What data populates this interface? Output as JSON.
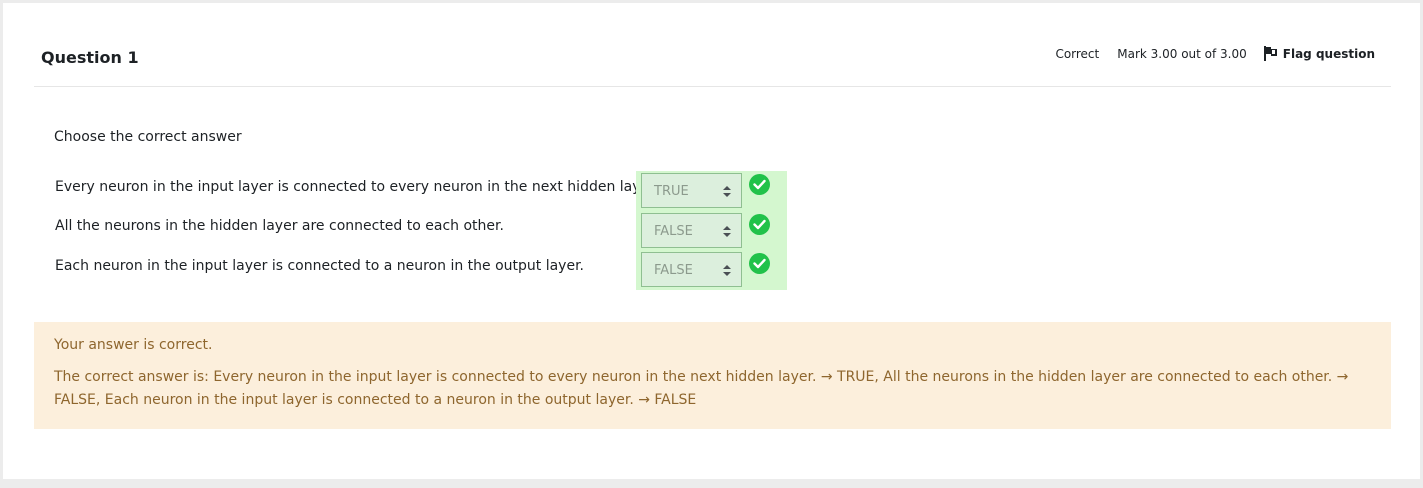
{
  "question": {
    "title": "Question 1",
    "state": "Correct",
    "grade": "Mark 3.00 out of 3.00",
    "flag_label": "Flag question",
    "prompt": "Choose the correct answer"
  },
  "rows": [
    {
      "text": "Every neuron in the input layer is connected to every neuron in the next hidden layer.",
      "selected": "TRUE"
    },
    {
      "text": "All the neurons in the hidden layer are connected to each other.",
      "selected": "FALSE"
    },
    {
      "text": "Each neuron in the input layer is connected to a neuron in the output layer.",
      "selected": "FALSE"
    }
  ],
  "feedback": {
    "specific": "Your answer is correct.",
    "right_answer": "The correct answer is: Every neuron in the input layer is connected to every neuron in the next hidden layer. → TRUE, All the neurons in the hidden layer are connected to each other. → FALSE, Each neuron in the input layer is connected to a neuron in the output layer. → FALSE"
  },
  "colors": {
    "correct_bg": "#d4f7cf",
    "check": "#21c24a",
    "feedback_bg": "#fcefdc",
    "feedback_text": "#8e662e"
  },
  "icons": [
    "flag-icon",
    "check-icon",
    "select-arrows-icon"
  ]
}
